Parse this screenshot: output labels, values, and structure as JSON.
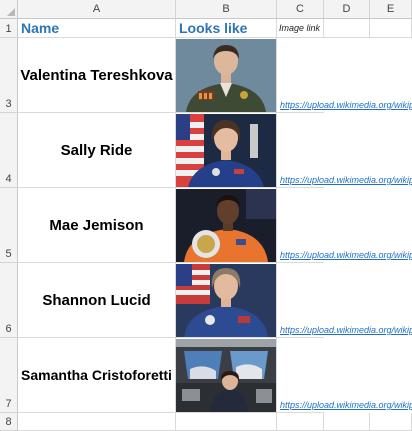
{
  "columns": [
    "A",
    "B",
    "C",
    "D",
    "E"
  ],
  "row_numbers": [
    "1",
    "3",
    "4",
    "5",
    "6",
    "7",
    "8"
  ],
  "headers": {
    "name": "Name",
    "looks_like": "Looks like",
    "image_link": "Image link"
  },
  "rows": [
    {
      "name": "Valentina Tereshkova",
      "link": "https://upload.wikimedia.org/wikipe"
    },
    {
      "name": "Sally Ride",
      "link": "https://upload.wikimedia.org/wikipe"
    },
    {
      "name": "Mae Jemison",
      "link": "https://upload.wikimedia.org/wikipe"
    },
    {
      "name": "Shannon Lucid",
      "link": "https://upload.wikimedia.org/wikipe"
    },
    {
      "name": "Samantha Cristoforetti",
      "link": "https://upload.wikimedia.org/wikipe"
    }
  ],
  "colors": {
    "header_text": "#2e75b6",
    "link_text": "#1f6fc5"
  }
}
